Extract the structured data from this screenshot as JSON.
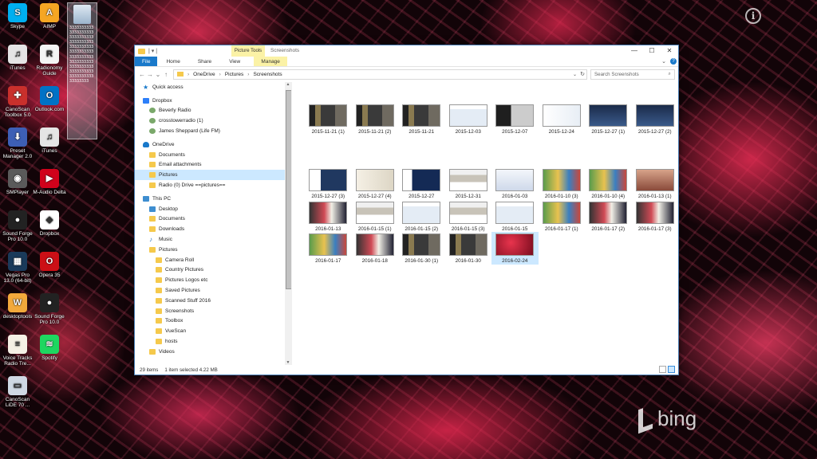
{
  "desktop": {
    "icons": [
      {
        "label": "Skype",
        "color": "#00aff0",
        "glyph": "S"
      },
      {
        "label": "AIMP",
        "color": "#f5a623",
        "glyph": "A"
      },
      {
        "label": "iTunes",
        "color": "#e5e5e5",
        "glyph": "♫"
      },
      {
        "label": "Radionomy Guide",
        "color": "#f4f4f4",
        "glyph": "R"
      },
      {
        "label": "CanoScan Toolbox 5.0",
        "color": "#c9302c",
        "glyph": "✚"
      },
      {
        "label": "Outlook.com",
        "color": "#0072c6",
        "glyph": "O"
      },
      {
        "label": "Preset Manager 2.0",
        "color": "#3d5fb5",
        "glyph": "⬇"
      },
      {
        "label": "iTunes",
        "color": "#e5e5e5",
        "glyph": "♫"
      },
      {
        "label": "SMPlayer",
        "color": "#5a5a5a",
        "glyph": "◉"
      },
      {
        "label": "M-Audio Delta",
        "color": "#d0021b",
        "glyph": "▶"
      },
      {
        "label": "Sound Forge Pro 10.0",
        "color": "#222222",
        "glyph": "●"
      },
      {
        "label": "Dropbox",
        "color": "#ffffff",
        "glyph": "◆"
      },
      {
        "label": "Vegas Pro 13.0 (64-bit)",
        "color": "#1a3a5a",
        "glyph": "▦"
      },
      {
        "label": "Opera 35",
        "color": "#cc0f16",
        "glyph": "O"
      },
      {
        "label": "desktoptools",
        "color": "#f2a93b",
        "glyph": "W"
      },
      {
        "label": "Sound Forge Pro 10.0",
        "color": "#222222",
        "glyph": "●"
      },
      {
        "label": "Voice Tracks Radio Tre...",
        "color": "#f5f0e5",
        "glyph": "≡"
      },
      {
        "label": "Spotify",
        "color": "#1ed760",
        "glyph": "≋"
      },
      {
        "label": "CanoScan LiDE 70 ...",
        "color": "#cfd8e3",
        "glyph": "▭"
      }
    ],
    "recycle_text": "3333333333333333333333333333333333333333333333333333333333333333333333333333333333333333333333333333333333333333333333",
    "bing_label": "bing"
  },
  "window": {
    "title": "Screenshots",
    "context_tab": "Picture Tools",
    "ribbon_tabs": {
      "file": "File",
      "home": "Home",
      "share": "Share",
      "view": "View",
      "manage": "Manage"
    },
    "address": {
      "parts": [
        "OneDrive",
        "Pictures",
        "Screenshots"
      ]
    },
    "search_placeholder": "Search Screenshots",
    "nav": [
      {
        "label": "Quick access",
        "icon": "star",
        "level": 0,
        "gap": false
      },
      {
        "label": "Dropbox",
        "icon": "dropbox",
        "level": 0,
        "gap": true
      },
      {
        "label": "Beverly Radio",
        "icon": "user",
        "level": 1,
        "gap": false
      },
      {
        "label": "crosstowerradio (1)",
        "icon": "user",
        "level": 1,
        "gap": false
      },
      {
        "label": "James Sheppard (Life FM)",
        "icon": "user",
        "level": 1,
        "gap": false
      },
      {
        "label": "OneDrive",
        "icon": "cloud",
        "level": 0,
        "gap": true
      },
      {
        "label": "Documents",
        "icon": "folder",
        "level": 1,
        "gap": false
      },
      {
        "label": "Email attachments",
        "icon": "folder",
        "level": 1,
        "gap": false
      },
      {
        "label": "Pictures",
        "icon": "folder",
        "level": 1,
        "gap": false,
        "selected": true
      },
      {
        "label": "Radio (0) Drive ==pictures==",
        "icon": "folder",
        "level": 1,
        "gap": false
      },
      {
        "label": "This PC",
        "icon": "pc",
        "level": 0,
        "gap": true
      },
      {
        "label": "Desktop",
        "icon": "pc",
        "level": 1,
        "gap": false
      },
      {
        "label": "Documents",
        "icon": "folder",
        "level": 1,
        "gap": false
      },
      {
        "label": "Downloads",
        "icon": "folder",
        "level": 1,
        "gap": false
      },
      {
        "label": "Music",
        "icon": "music",
        "level": 1,
        "gap": false
      },
      {
        "label": "Pictures",
        "icon": "folder",
        "level": 1,
        "gap": false
      },
      {
        "label": "Camera Roll",
        "icon": "folder",
        "level": 2,
        "gap": false
      },
      {
        "label": "Country Pictures",
        "icon": "folder",
        "level": 2,
        "gap": false
      },
      {
        "label": "Pictures Logos etc",
        "icon": "folder",
        "level": 2,
        "gap": false
      },
      {
        "label": "Saved Pictures",
        "icon": "folder",
        "level": 2,
        "gap": false
      },
      {
        "label": "Scanned Stuff 2016",
        "icon": "folder",
        "level": 2,
        "gap": false
      },
      {
        "label": "Screenshots",
        "icon": "folder",
        "level": 2,
        "gap": false
      },
      {
        "label": "Toolbox",
        "icon": "folder",
        "level": 2,
        "gap": false
      },
      {
        "label": "VueScan",
        "icon": "folder",
        "level": 2,
        "gap": false
      },
      {
        "label": "hosts",
        "icon": "folder",
        "level": 2,
        "gap": false
      },
      {
        "label": "Videos",
        "icon": "folder",
        "level": 1,
        "gap": false
      }
    ],
    "files": [
      {
        "name": "2015-11-21 (1)",
        "thumb": "t-dark"
      },
      {
        "name": "2015-11-21 (2)",
        "thumb": "t-dark"
      },
      {
        "name": "2015-11-21",
        "thumb": "t-dark"
      },
      {
        "name": "2015-12-03",
        "thumb": "t-win"
      },
      {
        "name": "2015-12-07",
        "thumb": "t-mono"
      },
      {
        "name": "2015-12-24",
        "thumb": "t-light"
      },
      {
        "name": "2015-12-27 (1)",
        "thumb": "t-blue"
      },
      {
        "name": "2015-12-27 (2)",
        "thumb": "t-blue"
      },
      {
        "name": "",
        "thumb": "blank"
      },
      {
        "name": "",
        "thumb": "blank"
      },
      {
        "name": "",
        "thumb": "blank"
      },
      {
        "name": "",
        "thumb": "blank"
      },
      {
        "name": "",
        "thumb": "blank"
      },
      {
        "name": "",
        "thumb": "blank"
      },
      {
        "name": "",
        "thumb": "blank"
      },
      {
        "name": "",
        "thumb": "blank"
      },
      {
        "name": "2015-12-27 (3)",
        "thumb": "t-blue2"
      },
      {
        "name": "2015-12-27 (4)",
        "thumb": "t-paper"
      },
      {
        "name": "2015-12-27",
        "thumb": "t-desk"
      },
      {
        "name": "2015-12-31",
        "thumb": "t-web"
      },
      {
        "name": "2016-01-03",
        "thumb": "t-pale"
      },
      {
        "name": "2016-01-10 (3)",
        "thumb": "t-colorful"
      },
      {
        "name": "2016-01-10 (4)",
        "thumb": "t-colorful"
      },
      {
        "name": "2016-01-13 (1)",
        "thumb": "t-brown"
      },
      {
        "name": "2016-01-13",
        "thumb": "t-mixed"
      },
      {
        "name": "2016-01-15 (1)",
        "thumb": "t-web"
      },
      {
        "name": "2016-01-15 (2)",
        "thumb": "t-win"
      },
      {
        "name": "2016-01-15 (3)",
        "thumb": "t-web"
      },
      {
        "name": "2016-01-15",
        "thumb": "t-win"
      },
      {
        "name": "2016-01-17 (1)",
        "thumb": "t-colorful"
      },
      {
        "name": "2016-01-17 (2)",
        "thumb": "t-mixed"
      },
      {
        "name": "2016-01-17 (3)",
        "thumb": "t-mixed"
      },
      {
        "name": "2016-01-17",
        "thumb": "t-colorful"
      },
      {
        "name": "2016-01-18",
        "thumb": "t-mixed"
      },
      {
        "name": "2016-01-30 (1)",
        "thumb": "t-dark"
      },
      {
        "name": "2016-01-30",
        "thumb": "t-dark"
      },
      {
        "name": "2016-02-24",
        "thumb": "t-red",
        "selected": true
      }
    ],
    "status": {
      "count": "29 items",
      "selection": "1 item selected  4.22 MB"
    }
  }
}
